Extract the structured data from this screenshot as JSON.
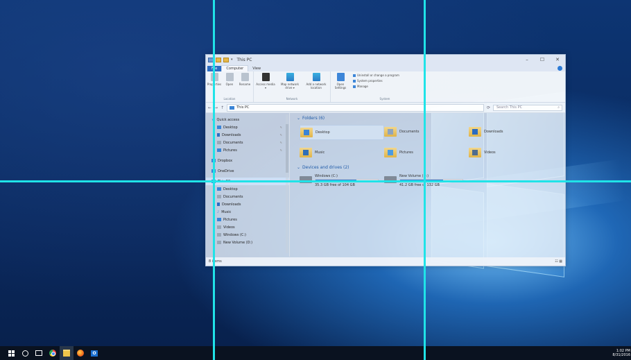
{
  "overlay": {
    "color": "#20e3e8"
  },
  "explorer": {
    "title": "This PC",
    "window_controls": [
      "–",
      "☐",
      "✕"
    ],
    "tabs": {
      "file": "File",
      "computer": "Computer",
      "view": "View"
    },
    "ribbon": {
      "location": {
        "label": "Location",
        "buttons": [
          "Properties",
          "Open",
          "Rename"
        ]
      },
      "network": {
        "label": "Network",
        "buttons": [
          "Access media ▾",
          "Map network drive ▾",
          "Add a network location"
        ]
      },
      "system": {
        "label": "System",
        "open_settings": "Open Settings",
        "items": [
          "Uninstall or change a program",
          "System properties",
          "Manage"
        ]
      }
    },
    "address": {
      "back": "←",
      "forward": "→",
      "up": "↑",
      "path": "This PC",
      "refresh": "⟳",
      "search_placeholder": "Search This PC"
    },
    "nav": {
      "quick_access": "Quick access",
      "quick_items": [
        "Desktop",
        "Downloads",
        "Documents",
        "Pictures"
      ],
      "dropbox": "Dropbox",
      "onedrive": "OneDrive",
      "this_pc": "This PC",
      "pc_items": [
        "Desktop",
        "Documents",
        "Downloads",
        "Music",
        "Pictures",
        "Videos",
        "Windows (C:)",
        "New Volume (D:)"
      ]
    },
    "content": {
      "folders_header": "Folders (6)",
      "folders": [
        "Desktop",
        "Documents",
        "Downloads",
        "Music",
        "Pictures",
        "Videos"
      ],
      "devices_header": "Devices and drives (2)",
      "drives": [
        {
          "name": "Windows (C:)",
          "free": "35.3 GB free of 104 GB",
          "used": 0.66
        },
        {
          "name": "New Volume (D:)",
          "free": "41.2 GB free of 132 GB",
          "used": 0.69
        }
      ]
    },
    "status": {
      "items": "8 items"
    }
  },
  "taskbar": {
    "time": "1:02 PM",
    "date": "8/31/2016"
  }
}
